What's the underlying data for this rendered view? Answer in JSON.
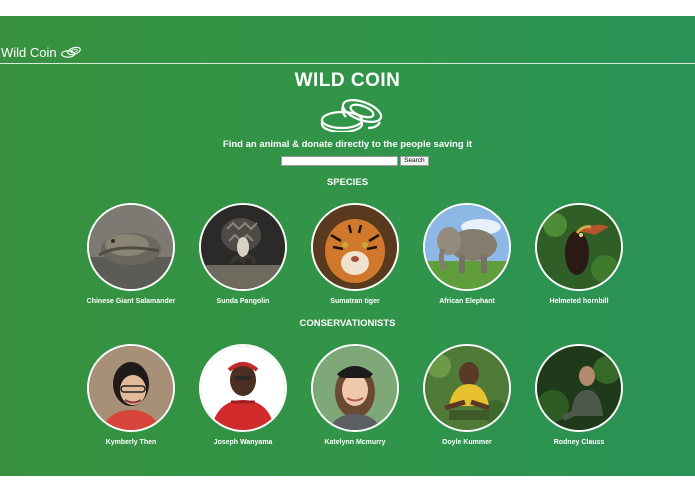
{
  "navbar": {
    "brand": "Wild Coin",
    "brand_icon": "coins-icon"
  },
  "header": {
    "title": "WILD COIN",
    "logo_icon": "coins-icon",
    "tagline": "Find an animal & donate directly to the people saving it"
  },
  "search": {
    "value": "",
    "placeholder": "",
    "button_label": "Search"
  },
  "species": {
    "heading": "SPECIES",
    "items": [
      {
        "label": "Chinese Giant Salamander"
      },
      {
        "label": "Sunda Pangolin"
      },
      {
        "label": "Sumatran tiger"
      },
      {
        "label": "African Elephant"
      },
      {
        "label": "Helmeted hornbill"
      }
    ]
  },
  "conservationists": {
    "heading": "CONSERVATIONISTS",
    "items": [
      {
        "label": "Kymberly Then"
      },
      {
        "label": "Joseph Wanyama"
      },
      {
        "label": "Katelynn Mcmurry"
      },
      {
        "label": "Doyle Kummer"
      },
      {
        "label": "Rodney Clauss"
      }
    ]
  },
  "colors": {
    "background_left": "#37913f",
    "background_right": "#2a9256",
    "text": "#ffffff"
  }
}
